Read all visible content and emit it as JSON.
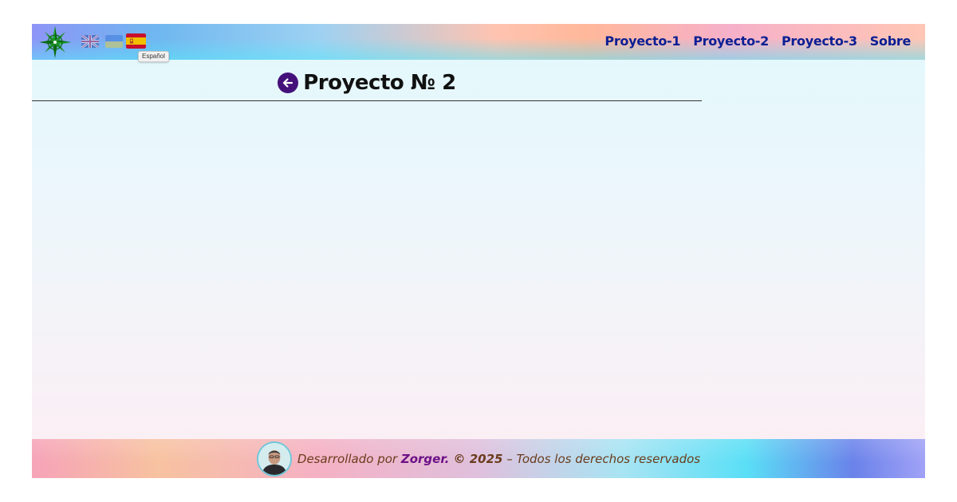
{
  "header": {
    "languages": [
      {
        "code": "gb",
        "icon": "flag-gb-icon"
      },
      {
        "code": "ua",
        "icon": "flag-ua-icon"
      },
      {
        "code": "es",
        "icon": "flag-es-icon"
      }
    ],
    "tooltip": "Español",
    "nav": [
      "Proyecto-1",
      "Proyecto-2",
      "Proyecto-3",
      "Sobre"
    ]
  },
  "page": {
    "title": "Proyecto № 2"
  },
  "footer": {
    "prefix": "Desarrollado por ",
    "author": "Zorger.",
    "copyright": " © 2025",
    "suffix": " – Todos los derechos reservados"
  },
  "colors": {
    "nav_link": "#0a1f93",
    "back_button": "#44117a",
    "author": "#6c1187",
    "footer_text": "#6a3c1c"
  }
}
